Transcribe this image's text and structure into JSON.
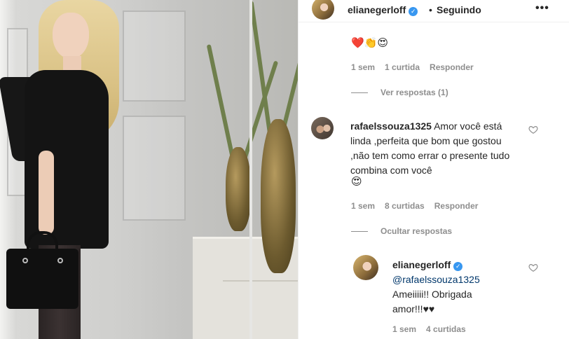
{
  "post": {
    "photo_description_icon": "photo-of-woman-icon"
  },
  "header": {
    "username": "elianegerloff",
    "separator": "•",
    "follow_status": "Seguindo",
    "more_icon": "more-options-icon"
  },
  "top_comment": {
    "emojis": "❤️👏😍",
    "time": "1 sem",
    "likes": "1 curtida",
    "reply": "Responder",
    "view_replies": "Ver respostas (1)"
  },
  "comment_rafael": {
    "username": "rafaelssouza1325",
    "text": "Amor você está linda ,perfeita que bom que gostou ,não tem como errar o presente tudo combina com você",
    "emoji": "😍",
    "time": "1 sem",
    "likes": "8 curtidas",
    "reply": "Responder",
    "hide_replies": "Ocultar respostas"
  },
  "reply_eliane": {
    "username": "elianegerloff",
    "mention": "@rafaelssouza1325",
    "text_line1": "Ameiiiii!! Obrigada",
    "text_line2": "amor!!!♥♥",
    "time": "1 sem",
    "likes": "4 curtidas"
  },
  "colors": {
    "verified": "#3897f0",
    "secondary_text": "#8e8e8e",
    "mention": "#00376b"
  }
}
